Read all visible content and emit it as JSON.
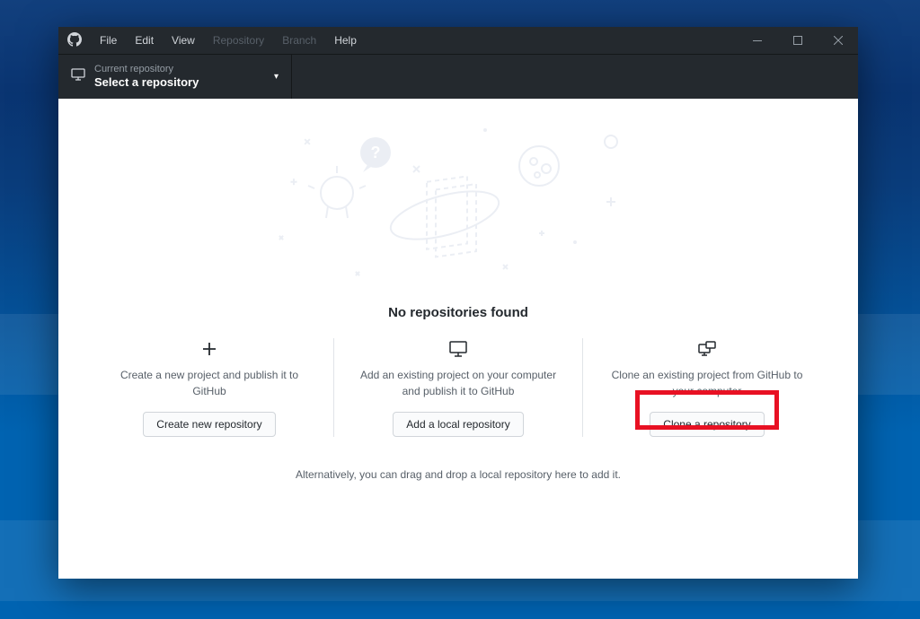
{
  "menu": {
    "items": [
      "File",
      "Edit",
      "View",
      "Repository",
      "Branch",
      "Help"
    ],
    "disabled_indices": [
      3,
      4
    ]
  },
  "toolbar": {
    "repo_label": "Current repository",
    "repo_value": "Select a repository"
  },
  "content": {
    "headline": "No repositories found",
    "alt_text": "Alternatively, you can drag and drop a local repository here to add it.",
    "options": [
      {
        "desc": "Create a new project and publish it to GitHub",
        "button": "Create new repository"
      },
      {
        "desc": "Add an existing project on your computer and publish it to GitHub",
        "button": "Add a local repository"
      },
      {
        "desc": "Clone an existing project from GitHub to your computer",
        "button": "Clone a repository"
      }
    ]
  }
}
